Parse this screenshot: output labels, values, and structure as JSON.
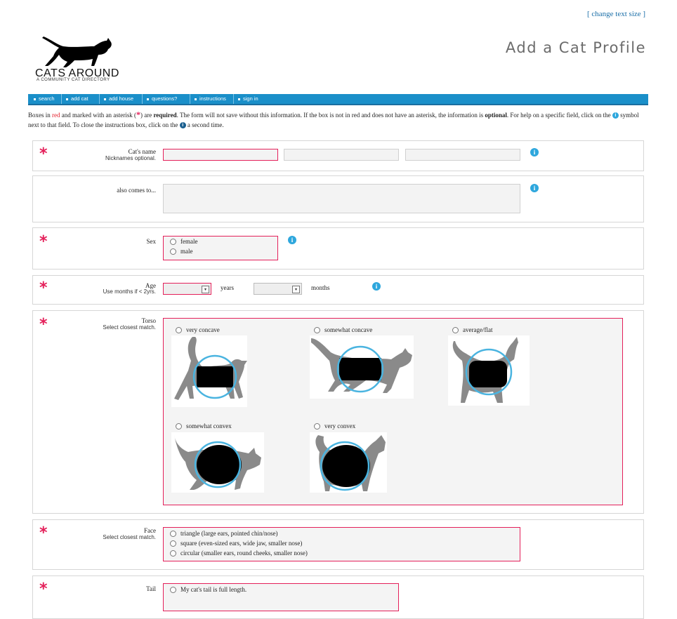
{
  "header": {
    "top_link": "[ change text size ]",
    "logo_text": "CATS AROUND",
    "logo_sub": "A COMMUNITY CAT DIRECTORY",
    "page_title": "Add a Cat Profile"
  },
  "nav": [
    "search",
    "add cat",
    "add house",
    "questions?",
    "instructions",
    "sign in"
  ],
  "instructions": {
    "t1": "Boxes in ",
    "t_red": "red",
    "t2": " and marked with an asterisk (",
    "t3": ") are ",
    "t_required": "required",
    "t4": ". The form will not save without this information. If the box is not in red and does not have an asterisk, the information is ",
    "t_optional": "optional",
    "t5": ". For help on a specific field, click on the ",
    "t6": " symbol next to that field. To close the instructions box, click on the ",
    "t7": " a second time."
  },
  "icons": {
    "asterisk": "*",
    "info": "i",
    "arrow": "▾"
  },
  "fields": {
    "name": {
      "label": "Cat's name",
      "sublabel": "Nicknames optional."
    },
    "also": {
      "label": "also comes to..."
    },
    "sex": {
      "label": "Sex",
      "options": [
        "female",
        "male"
      ]
    },
    "age": {
      "label": "Age",
      "sublabel": "Use months if < 2yrs.",
      "years": "years",
      "months": "months"
    },
    "torso": {
      "label": "Torso",
      "sublabel": "Select closest match.",
      "options": [
        "very concave",
        "somewhat concave",
        "average/flat",
        "somewhat convex",
        "very convex"
      ]
    },
    "face": {
      "label": "Face",
      "sublabel": "Select closest match.",
      "options": [
        "triangle (large ears, pointed chin/nose)",
        "square (even-sized ears, wide jaw, smaller nose)",
        "circular (smaller ears, round cheeks, smaller nose)"
      ]
    },
    "tail": {
      "label": "Tail",
      "options": [
        "My cat's tail is full length."
      ]
    }
  },
  "colors": {
    "nav": "#1a8fc9",
    "required": "#e4205a",
    "info": "#2ea7dd",
    "link": "#1b6fa8"
  }
}
